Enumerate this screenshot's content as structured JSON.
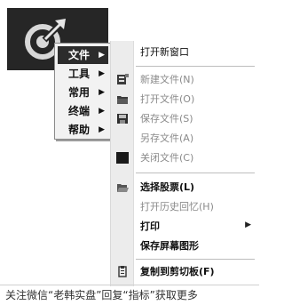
{
  "main_menu": {
    "items": [
      {
        "label": "文件",
        "arrow": "▶",
        "active": true
      },
      {
        "label": "工具",
        "arrow": "▶"
      },
      {
        "label": "常用",
        "arrow": "▶"
      },
      {
        "label": "终端",
        "arrow": "▶"
      },
      {
        "label": "帮助",
        "arrow": "▶"
      }
    ]
  },
  "file_menu": {
    "items": [
      {
        "label": "打开新窗口",
        "state": "normal"
      },
      {
        "label": "新建文件(N)",
        "state": "disabled",
        "icon": "new-file-icon"
      },
      {
        "label": "打开文件(O)",
        "state": "disabled",
        "icon": "open-folder-icon"
      },
      {
        "label": "保存文件(S)",
        "state": "disabled",
        "icon": "save-icon"
      },
      {
        "label": "另存文件(A)",
        "state": "disabled"
      },
      {
        "label": "关闭文件(C)",
        "state": "disabled",
        "icon": "close-file-icon"
      },
      {
        "label": "选择股票(L)",
        "state": "bold",
        "icon": "open-folder-icon"
      },
      {
        "label": "打开历史回忆(H)",
        "state": "disabled"
      },
      {
        "label": "打印",
        "state": "bold",
        "arrow": "▶"
      },
      {
        "label": "保存屏幕图形",
        "state": "bold"
      },
      {
        "label": "复制到剪切板(F)",
        "state": "bold",
        "icon": "clipboard-icon"
      }
    ]
  },
  "caption": "关注微信“老韩实盘”回复“指标”获取更多"
}
